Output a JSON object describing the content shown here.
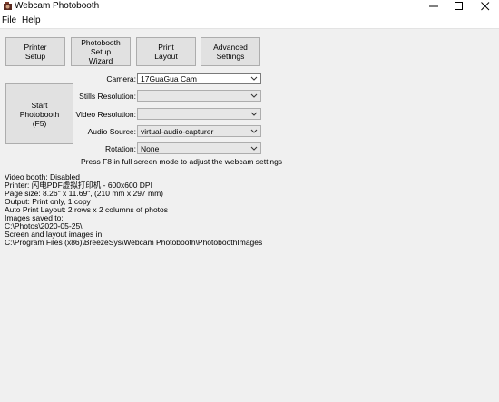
{
  "window": {
    "title": "Webcam Photobooth",
    "icon": "camera-app-icon"
  },
  "menu": [
    "File",
    "Help"
  ],
  "toolbar": {
    "printer_setup": "Printer\nSetup",
    "wizard": "Photobooth\nSetup\nWizard",
    "print_layout": "Print\nLayout",
    "advanced": "Advanced\nSettings"
  },
  "start_button": "Start\nPhotobooth\n(F5)",
  "fields": {
    "camera": {
      "label": "Camera:",
      "value": "17GuaGua Cam"
    },
    "stills": {
      "label": "Stills Resolution:",
      "value": ""
    },
    "video": {
      "label": "Video Resolution:",
      "value": ""
    },
    "audio": {
      "label": "Audio Source:",
      "value": "virtual-audio-capturer"
    },
    "rotation": {
      "label": "Rotation:",
      "value": "None"
    }
  },
  "hint": "Press F8 in full screen mode to adjust the webcam settings",
  "info": [
    "Video booth: Disabled",
    "Printer: 闪电PDF虚拟打印机 - 600x600 DPI",
    "Page size: 8.26\" x 11.69\", (210 mm x 297 mm)",
    "Output: Print only, 1 copy",
    "Auto Print Layout: 2 rows x 2 columns of photos",
    "Images saved to:",
    "C:\\Photos\\2020-05-25\\",
    "Screen and layout images in:",
    "C:\\Program Files (x86)\\BreezeSys\\Webcam Photobooth\\PhotoboothImages"
  ]
}
